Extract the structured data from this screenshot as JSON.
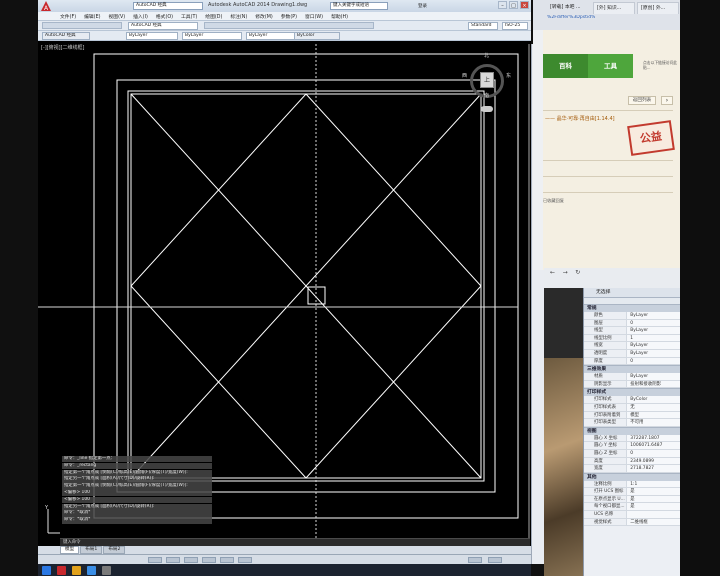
{
  "cad": {
    "app_title": "Autodesk AutoCAD 2014    Drawing1.dwg",
    "workspace": "AutoCAD 经典",
    "search_placeholder": "键入关键字或短语",
    "user_label": "登录",
    "menus": [
      "文件(F)",
      "编辑(E)",
      "视图(V)",
      "插入(I)",
      "格式(O)",
      "工具(T)",
      "绘图(D)",
      "标注(N)",
      "修改(M)",
      "参数(P)",
      "窗口(W)",
      "帮助(H)"
    ],
    "toolbar_workspace": "AutoCAD 经典",
    "layer_value": "ByLayer",
    "linetype_value": "ByLayer",
    "lineweight_value": "ByLayer",
    "plotstyle_value": "ByColor",
    "textstyle_value": "Standard",
    "dimstyle_value": "ISO-25",
    "viewport_label": "[-][俯视][二维线框]",
    "viewcube": {
      "top_face": "上",
      "north": "北",
      "south": "南",
      "east": "东",
      "west": "西"
    },
    "command_history": [
      "命令：_line 指定第一点：",
      "命令：_rectang",
      "指定第一个角点或 [倒角(C)/标高(E)/圆角(F)/厚度(T)/宽度(W)]:",
      "指定另一个角点或 [面积(A)/尺寸(D)/旋转(R)]:",
      "指定第一个角点或 [倒角(C)/标高(E)/圆角(F)/厚度(T)/宽度(W)]:",
      "<偏移> 100",
      "<偏移> 100",
      "指定另一个角点或 [面积(A)/尺寸(D)/旋转(R)]:",
      "命令：*取消*",
      "命令：*取消*"
    ],
    "command_prompt": "键入命令",
    "layout_tabs": [
      "模型",
      "布局1",
      "布局2"
    ],
    "status_coords": "",
    "icons": [
      "autocad-logo-icon",
      "minimize-icon",
      "maximize-icon",
      "close-icon"
    ]
  },
  "browser": {
    "tabs": [
      "[转载] 本吧 ...",
      "[外] 知识...",
      "[原创] 外..."
    ],
    "url_fragment": "%2Fdiffer%3Dpstid%3D%2Fsearchoption",
    "nav_tabs": [
      "百科",
      "工具"
    ],
    "notice_text": "点击以下链接访问此贴...",
    "back_button": "返回列表",
    "next_button": "›",
    "thread_title": "—— 晶华·可靠·再自由[1.14.4]",
    "stamp_text": "公益",
    "reply_note": "已收藏回复"
  },
  "properties": {
    "selector": "无选择",
    "sections": [
      {
        "name": "常规",
        "rows": [
          [
            "颜色",
            "ByLayer"
          ],
          [
            "图层",
            "0"
          ],
          [
            "线型",
            "ByLayer"
          ],
          [
            "线型比例",
            "1"
          ],
          [
            "线宽",
            "ByLayer"
          ],
          [
            "透明度",
            "ByLayer"
          ],
          [
            "厚度",
            "0"
          ]
        ]
      },
      {
        "name": "三维效果",
        "rows": [
          [
            "材质",
            "ByLayer"
          ],
          [
            "阴影显示",
            "投射和接收阴影"
          ]
        ]
      },
      {
        "name": "打印样式",
        "rows": [
          [
            "打印样式",
            "ByColor"
          ],
          [
            "打印样式表",
            "无"
          ],
          [
            "打印表附着到",
            "模型"
          ],
          [
            "打印表类型",
            "不可用"
          ]
        ]
      },
      {
        "name": "视图",
        "rows": [
          [
            "圆心 X 坐标",
            "372287.1807"
          ],
          [
            "圆心 Y 坐标",
            "1006071.6487"
          ],
          [
            "圆心 Z 坐标",
            "0"
          ],
          [
            "高度",
            "2349.0899"
          ],
          [
            "宽度",
            "2718.7827"
          ]
        ]
      },
      {
        "name": "其他",
        "rows": [
          [
            "注释比例",
            "1:1"
          ],
          [
            "打开 UCS 图标",
            "是"
          ],
          [
            "在原点显示 U...",
            "是"
          ],
          [
            "每个视口都显...",
            "是"
          ],
          [
            "UCS 名称",
            ""
          ],
          [
            "视觉样式",
            "二维线框"
          ]
        ]
      }
    ]
  },
  "colors": {
    "cad_canvas": "#000000",
    "drawing_lines": "#ffffff",
    "browser_green": "#4ea63c",
    "stamp_red": "#c23a2e"
  }
}
